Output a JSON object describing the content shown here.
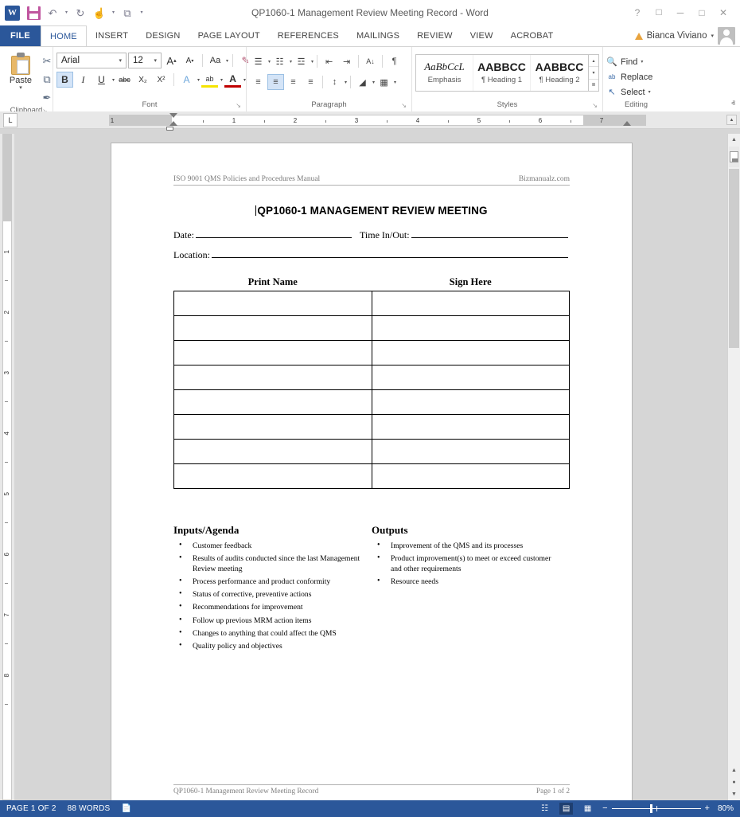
{
  "window": {
    "title": "QP1060-1 Management Review Meeting Record - Word",
    "logo_text": "W",
    "help_icon": "?",
    "ribbon_display_icon": "⬜",
    "minimize_icon": "─",
    "restore_icon": "□",
    "close_icon": "✕"
  },
  "quick_access": [
    {
      "name": "save",
      "icon": "save-icon"
    },
    {
      "name": "undo",
      "icon": "↶"
    },
    {
      "name": "redo",
      "icon": "↻"
    },
    {
      "name": "touch-mode",
      "icon": "☝"
    },
    {
      "name": "customize",
      "icon": "▾"
    }
  ],
  "tabs": {
    "file": "FILE",
    "items": [
      {
        "label": "HOME",
        "active": true
      },
      {
        "label": "INSERT",
        "active": false
      },
      {
        "label": "DESIGN",
        "active": false
      },
      {
        "label": "PAGE LAYOUT",
        "active": false
      },
      {
        "label": "REFERENCES",
        "active": false
      },
      {
        "label": "MAILINGS",
        "active": false
      },
      {
        "label": "REVIEW",
        "active": false
      },
      {
        "label": "VIEW",
        "active": false
      },
      {
        "label": "ACROBAT",
        "active": false
      }
    ]
  },
  "account": {
    "name": "Bianca Viviano",
    "caret": "▾"
  },
  "ribbon": {
    "clipboard": {
      "label": "Clipboard",
      "paste_label": "Paste",
      "paste_caret": "▾",
      "cut_icon": "✂",
      "copy_icon": "⧉",
      "format_painter_icon": "✒",
      "dialog_launcher": "↘"
    },
    "font": {
      "label": "Font",
      "font_name": "Arial",
      "font_size": "12",
      "grow_font": "A",
      "shrink_font": "A",
      "change_case": "Aa",
      "clear_format": "✐",
      "bold": "B",
      "italic": "I",
      "underline": "U",
      "strikethrough": "abc",
      "subscript": "X₂",
      "superscript": "X²",
      "text_effects": "A",
      "highlight": "ab",
      "font_color": "A",
      "dialog_launcher": "↘"
    },
    "paragraph": {
      "label": "Paragraph",
      "bullets": "☰",
      "numbering": "☷",
      "multilevel": "☲",
      "decrease_indent": "⇤",
      "increase_indent": "⇥",
      "sort": "A↓",
      "show_marks": "¶",
      "align_left": "≡",
      "align_center": "≡",
      "align_right": "≡",
      "justify": "≡",
      "line_spacing": "↕",
      "shading": "◢",
      "borders": "▦",
      "dialog_launcher": "↘"
    },
    "styles": {
      "label": "Styles",
      "items": [
        {
          "preview": "AaBbCcL",
          "name": "Emphasis"
        },
        {
          "preview": "AABBCC",
          "name": "¶ Heading 1"
        },
        {
          "preview": "AABBCC",
          "name": "¶ Heading 2"
        }
      ],
      "scroll_up": "▴",
      "scroll_down": "▾",
      "more": "≣",
      "dialog_launcher": "↘"
    },
    "editing": {
      "label": "Editing",
      "find": "Find",
      "find_caret": "▾",
      "replace": "Replace",
      "select": "Select",
      "select_caret": "▾",
      "find_icon": "🔍",
      "replace_icon": "ab",
      "select_icon": "↖"
    },
    "collapse_icon": "ⱏ"
  },
  "ruler": {
    "tab_selector": "L",
    "h_numbers": [
      "1",
      "1",
      "2",
      "3",
      "4",
      "5",
      "6",
      "7"
    ],
    "v_numbers": [
      "1",
      "2",
      "3",
      "4",
      "5",
      "6",
      "7",
      "8"
    ]
  },
  "document": {
    "header_left": "ISO 9001 QMS Policies and Procedures Manual",
    "header_right": "Bizmanualz.com",
    "title": "QP1060-1 MANAGEMENT REVIEW MEETING",
    "fields": [
      {
        "label": "Date:"
      },
      {
        "label": "Time In/Out:"
      },
      {
        "label": "Location:"
      }
    ],
    "table": {
      "columns": [
        "Print Name",
        "Sign Here"
      ],
      "row_count": 8
    },
    "inputs": {
      "heading": "Inputs/Agenda",
      "items": [
        "Customer feedback",
        "Results of audits conducted since the last Management Review meeting",
        "Process performance and product conformity",
        "Status of corrective, preventive actions",
        "Recommendations for improvement",
        "Follow up previous MRM action items",
        "Changes to anything that could affect the QMS",
        "Quality policy and objectives"
      ]
    },
    "outputs": {
      "heading": "Outputs",
      "items": [
        "Improvement of the QMS and its processes",
        "Product improvement(s) to meet or exceed customer and other requirements",
        "Resource needs"
      ]
    },
    "footer_left": "QP1060-1 Management Review Meeting Record",
    "footer_right": "Page 1 of 2"
  },
  "status_bar": {
    "page": "PAGE 1 OF 2",
    "words": "88 WORDS",
    "proofing_icon": "📖",
    "view_read": "☷",
    "view_print": "▤",
    "view_web": "▦",
    "zoom_out": "−",
    "zoom_in": "+",
    "zoom_value": "80%"
  },
  "colors": {
    "accent": "#2b579a",
    "status_bar": "#2b579a",
    "page_bg": "#d6d6d6"
  }
}
